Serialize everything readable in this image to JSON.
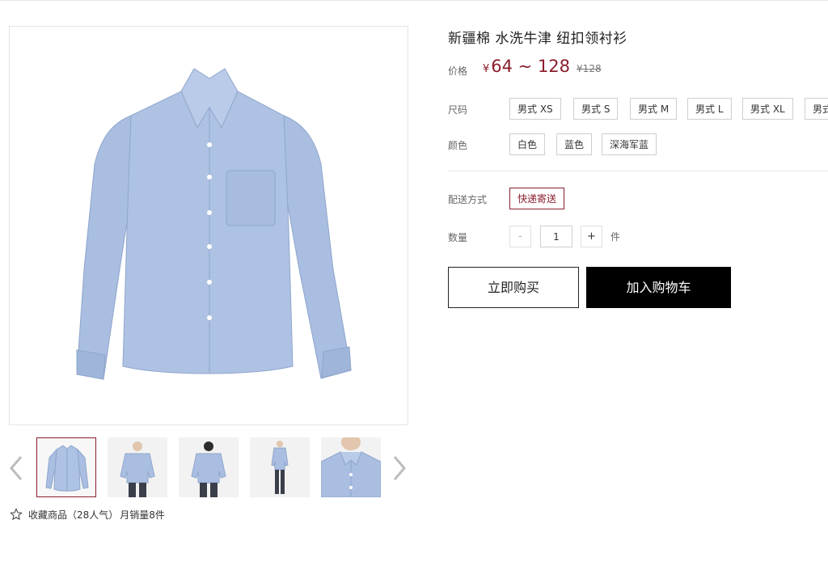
{
  "product": {
    "title": "新疆棉 水洗牛津 纽扣领衬衫",
    "price_label": "价格",
    "currency_symbol": "¥",
    "price_range": "64 ~ 128",
    "original_price": "¥128",
    "size_label": "尺码",
    "sizes": [
      "男式 XS",
      "男式 S",
      "男式 M",
      "男式 L",
      "男式 XL",
      "男式 XXL"
    ],
    "color_label": "颜色",
    "colors": [
      "白色",
      "蓝色",
      "深海军蓝"
    ],
    "delivery_label": "配送方式",
    "delivery_option": "快递寄送",
    "quantity_label": "数量",
    "quantity_value": "1",
    "quantity_minus": "-",
    "quantity_plus": "+",
    "quantity_unit": "件",
    "buy_now": "立即购买",
    "add_to_cart": "加入购物车"
  },
  "gallery": {
    "thumbnail_count": 5,
    "active_thumbnail": 1,
    "favorite_text": "收藏商品（28人气）",
    "monthly_sales": "月销量8件"
  },
  "colors": {
    "accent": "#8a1e2d",
    "shirt": "#a9bee0",
    "button_dark": "#000000"
  },
  "icons": {
    "favorite": "star-outline-icon",
    "prev": "chevron-left-icon",
    "next": "chevron-right-icon"
  }
}
